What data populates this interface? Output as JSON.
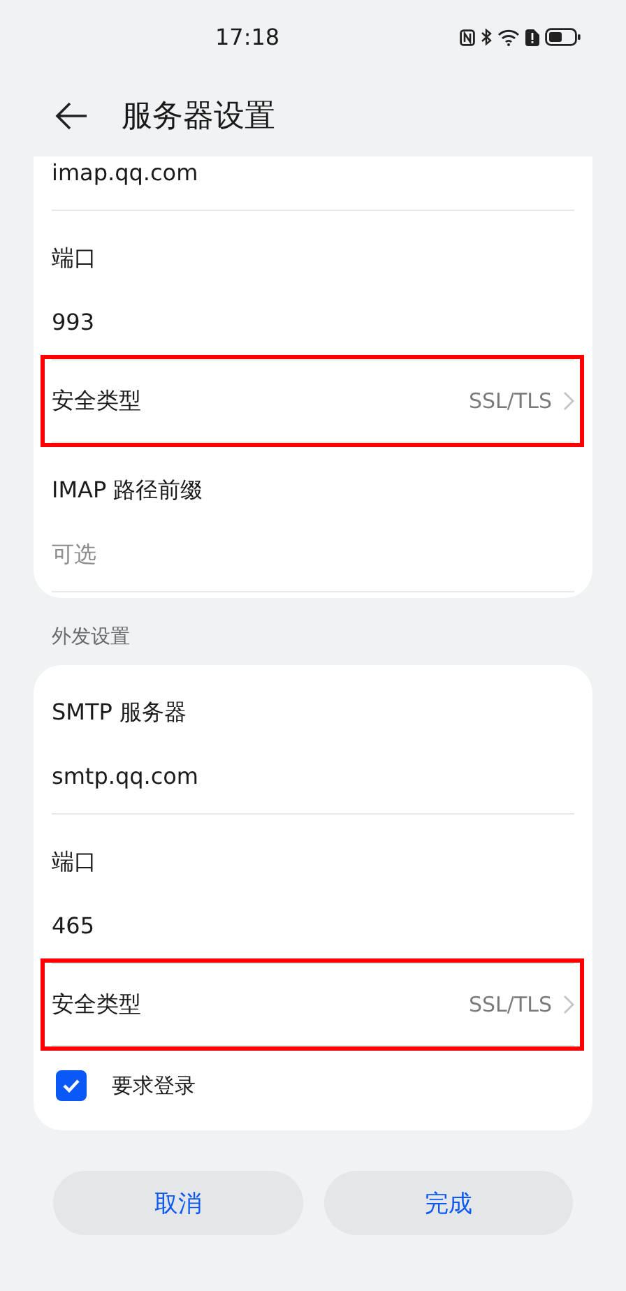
{
  "status_bar": {
    "time": "17:18"
  },
  "header": {
    "title": "服务器设置"
  },
  "sections": [
    {
      "rows": [
        {
          "kind": "value",
          "text": "imap.qq.com"
        },
        {
          "kind": "label",
          "text": "端口"
        },
        {
          "kind": "value",
          "text": "993"
        },
        {
          "kind": "select",
          "label": "安全类型",
          "value": "SSL/TLS",
          "highlighted": true
        },
        {
          "kind": "label",
          "text": "IMAP 路径前缀"
        },
        {
          "kind": "placeholder",
          "text": "可选"
        }
      ]
    },
    {
      "title": "外发设置",
      "rows": [
        {
          "kind": "label",
          "text": "SMTP 服务器"
        },
        {
          "kind": "value",
          "text": "smtp.qq.com"
        },
        {
          "kind": "label",
          "text": "端口"
        },
        {
          "kind": "value",
          "text": "465"
        },
        {
          "kind": "select",
          "label": "安全类型",
          "value": "SSL/TLS",
          "highlighted": true
        },
        {
          "kind": "checkbox",
          "label": "要求登录",
          "checked": true
        }
      ]
    }
  ],
  "buttons": [
    "取消",
    "完成"
  ]
}
